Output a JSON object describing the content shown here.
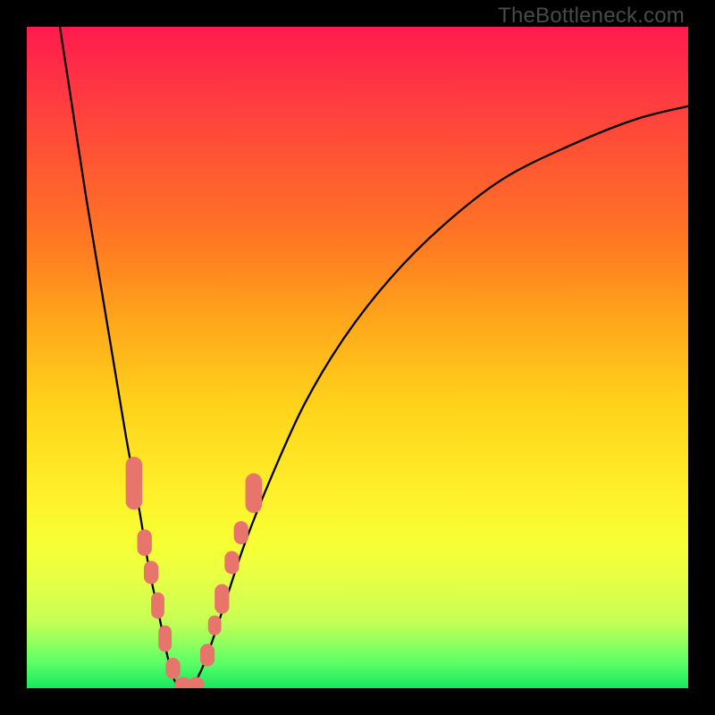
{
  "watermark": "TheBottleneck.com",
  "chart_data": {
    "type": "line",
    "title": "",
    "xlabel": "",
    "ylabel": "",
    "xlim": [
      0,
      100
    ],
    "ylim": [
      0,
      100
    ],
    "grid": false,
    "legend": false,
    "background_gradient": [
      "#ff1a4d",
      "#ffef2a",
      "#16e85f"
    ],
    "series": [
      {
        "name": "left-branch",
        "x": [
          5,
          7,
          9,
          11,
          13,
          15,
          17,
          18.5,
          20,
          21,
          22,
          23
        ],
        "y": [
          100,
          87,
          74,
          62,
          50,
          38,
          27,
          18,
          11,
          6,
          2,
          0
        ]
      },
      {
        "name": "right-branch",
        "x": [
          25,
          26.5,
          28,
          30,
          33,
          37,
          42,
          48,
          55,
          63,
          72,
          82,
          92,
          100
        ],
        "y": [
          0,
          3,
          7,
          13,
          22,
          32,
          43,
          53,
          62,
          70,
          77,
          82,
          86,
          88
        ]
      }
    ],
    "markers": {
      "color": "#e8756b",
      "shape": "rounded-bar",
      "points": [
        {
          "x": 16.2,
          "y": 31,
          "w": 2.5,
          "h": 8
        },
        {
          "x": 17.8,
          "y": 22,
          "w": 2.2,
          "h": 4
        },
        {
          "x": 18.8,
          "y": 17.5,
          "w": 2.2,
          "h": 3.5
        },
        {
          "x": 19.8,
          "y": 12.5,
          "w": 2.0,
          "h": 4
        },
        {
          "x": 20.9,
          "y": 7.5,
          "w": 2.0,
          "h": 4
        },
        {
          "x": 22.1,
          "y": 3.0,
          "w": 2.2,
          "h": 3.2
        },
        {
          "x": 23.6,
          "y": 0.6,
          "w": 2.5,
          "h": 2.2
        },
        {
          "x": 25.6,
          "y": 0.6,
          "w": 2.5,
          "h": 2.2
        },
        {
          "x": 27.3,
          "y": 5,
          "w": 2.2,
          "h": 3.4
        },
        {
          "x": 28.4,
          "y": 9.5,
          "w": 2.0,
          "h": 3
        },
        {
          "x": 29.5,
          "y": 13.5,
          "w": 2.2,
          "h": 4.5
        },
        {
          "x": 31.0,
          "y": 19,
          "w": 2.2,
          "h": 3.5
        },
        {
          "x": 32.4,
          "y": 23.5,
          "w": 2.2,
          "h": 3.5
        },
        {
          "x": 34.3,
          "y": 29.5,
          "w": 2.5,
          "h": 6
        }
      ]
    },
    "vertex": {
      "x": 24,
      "y": 0
    }
  }
}
